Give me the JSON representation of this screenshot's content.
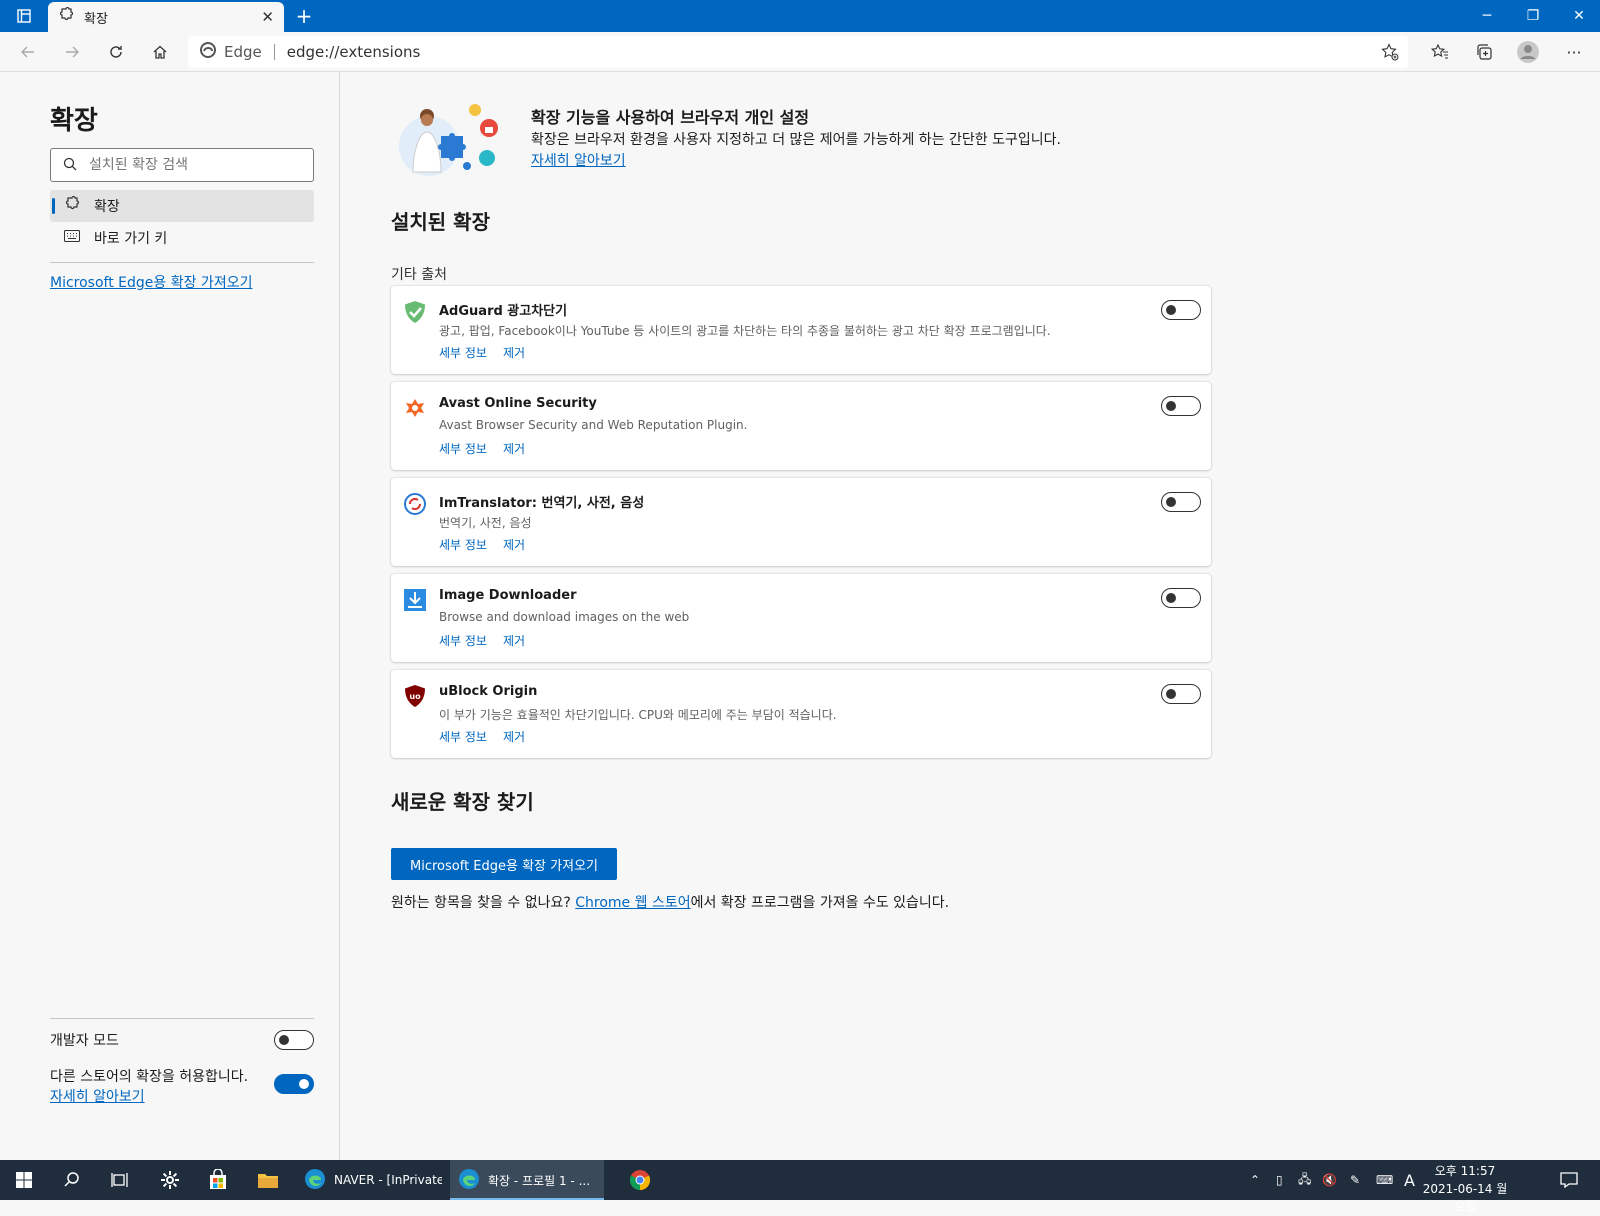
{
  "browser": {
    "tab_title": "확장",
    "address_brand": "Edge",
    "url": "edge://extensions"
  },
  "sidebar": {
    "title": "확장",
    "search_placeholder": "설치된 확장 검색",
    "nav": [
      {
        "label": "확장"
      },
      {
        "label": "바로 가기 키"
      }
    ],
    "store_link": "Microsoft Edge용 확장 가져오기",
    "dev_mode_label": "개발자 모드",
    "dev_mode_on": false,
    "other_stores_label": "다른 스토어의 확장을 허용합니다.",
    "other_stores_on": true,
    "learn_more": "자세히 알아보기"
  },
  "hero": {
    "title": "확장 기능을 사용하여 브라우저 개인 설정",
    "desc": "확장은 브라우저 환경을 사용자 지정하고 더 많은 제어를 가능하게 하는 간단한 도구입니다.",
    "learn_more": "자세히 알아보기"
  },
  "installed": {
    "title": "설치된 확장",
    "source_label": "기타 출처",
    "details_label": "세부 정보",
    "remove_label": "제거",
    "items": [
      {
        "name": "AdGuard 광고차단기",
        "desc": "광고, 팝업, Facebook이나 YouTube 등 사이트의 광고를 차단하는 타의 추종을 불허하는 광고 차단 확장 프로그램입니다.",
        "enabled": false
      },
      {
        "name": "Avast Online Security",
        "desc": "Avast Browser Security and Web Reputation Plugin.",
        "enabled": false
      },
      {
        "name": "ImTranslator: 번역기, 사전, 음성",
        "desc": "번역기, 사전, 음성",
        "enabled": false
      },
      {
        "name": "Image Downloader",
        "desc": "Browse and download images on the web",
        "enabled": false
      },
      {
        "name": "uBlock Origin",
        "desc": "이 부가 기능은 효율적인 차단기입니다. CPU와 메모리에 주는 부담이 적습니다.",
        "enabled": false
      }
    ]
  },
  "find_new": {
    "title": "새로운 확장 찾기",
    "button": "Microsoft Edge용 확장 가져오기",
    "footnote_pre": "원하는 항목을 찾을 수 없나요? ",
    "footnote_link": "Chrome 웹 스토어",
    "footnote_post": "에서 확장 프로그램을 가져올 수도 있습니다."
  },
  "taskbar": {
    "apps": [
      {
        "title": "NAVER - [InPrivate..."
      },
      {
        "title": "확장 - 프로필 1 - ..."
      }
    ],
    "ime": "A",
    "time": "오후 11:57",
    "date": "2021-06-14 월요일"
  },
  "colors": {
    "accent": "#0067c0",
    "taskbar": "#1f2d3d"
  }
}
